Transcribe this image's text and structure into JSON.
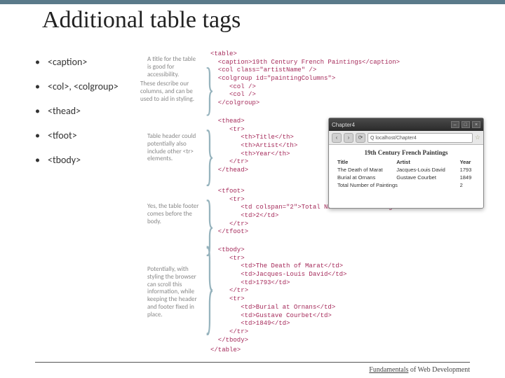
{
  "title": "Additional table tags",
  "bullets": {
    "b1": "<caption>",
    "b2": "<col>, <colgroup>",
    "b3": "<thead>",
    "b4": "<tfoot>",
    "b5": "<tbody>"
  },
  "notes": {
    "caption": "A title for the table is good for accessibility.",
    "col": "These describe our columns, and can be used to aid in styling.",
    "thead": "Table header could potentially also include other <tr> elements.",
    "tfoot": "Yes, the table footer comes before the body.",
    "tbody": "Potentially, with styling the browser can scroll this information, while keeping the header and footer fixed in place."
  },
  "code": {
    "top": "<table>\n  <caption>19th Century French Paintings</caption>\n  <col class=\"artistName\" />\n  <colgroup id=\"paintingColumns\">\n     <col />\n     <col />\n  </colgroup>",
    "thead": "  <thead>\n     <tr>\n        <th>Title</th>\n        <th>Artist</th>\n        <th>Year</th>\n     </tr>\n  </thead>",
    "tfoot": "  <tfoot>\n     <tr>\n        <td colspan=\"2\">Total Number of Paintings</td>\n        <td>2</td>\n     </tr>\n  </tfoot>",
    "tbody": "  <tbody>\n     <tr>\n        <td>The Death of Marat</td>\n        <td>Jacques-Louis David</td>\n        <td>1793</td>\n     </tr>\n     <tr>\n        <td>Burial at Ornans</td>\n        <td>Gustave Courbet</td>\n        <td>1849</td>\n     </tr>\n  </tbody>",
    "end": "</table>"
  },
  "browser": {
    "title": "Chapter4",
    "address": "Q  localhost/Chapter4",
    "caption": "19th Century French Paintings",
    "head": {
      "c1": "Title",
      "c2": "Artist",
      "c3": "Year"
    },
    "row1": {
      "c1": "The Death of Marat",
      "c2": "Jacques-Louis David",
      "c3": "1793"
    },
    "row2": {
      "c1": "Burial at Ornans",
      "c2": "Gustave Courbet",
      "c3": "1849"
    },
    "foot": {
      "label": "Total Number of Paintings",
      "val": "2"
    }
  },
  "footer": {
    "left": "Fundamentals",
    "right": " of Web Development"
  }
}
